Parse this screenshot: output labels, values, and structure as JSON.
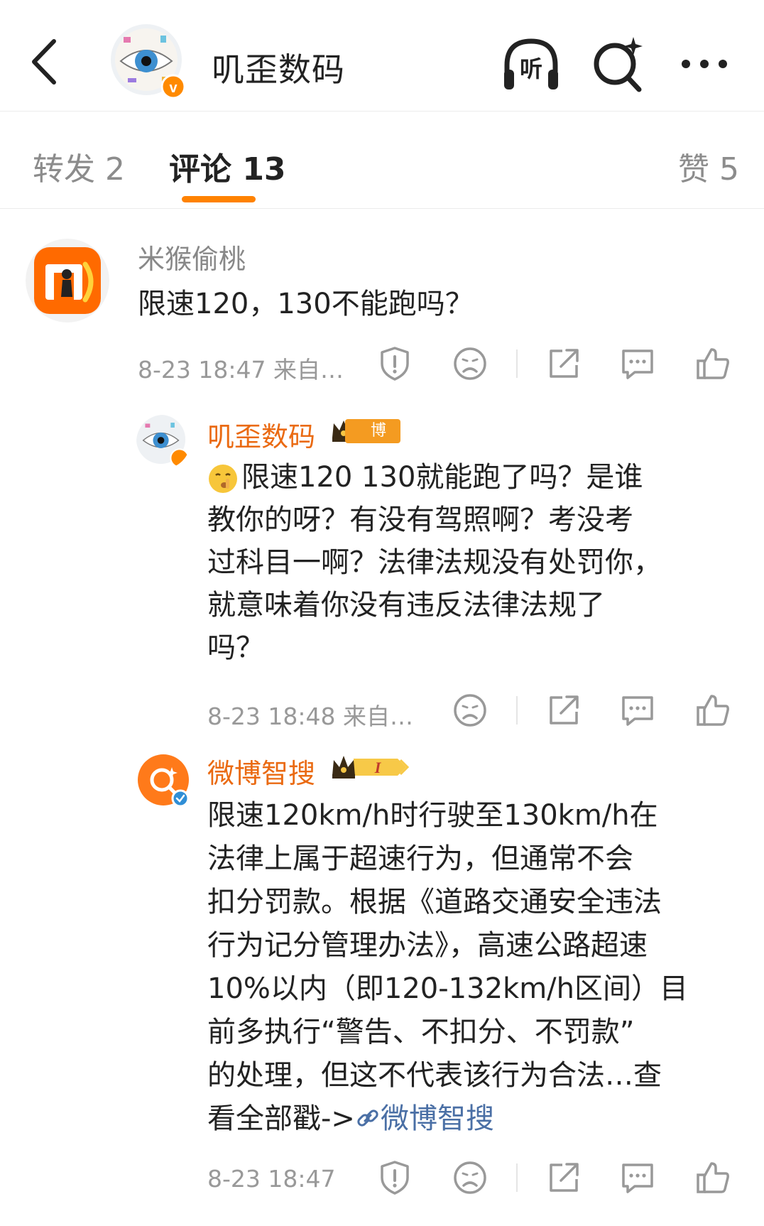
{
  "header": {
    "title": "叽歪数码",
    "listen_label": "听"
  },
  "tabs": [
    {
      "label": "转发 2"
    },
    {
      "label": "评论 13"
    },
    {
      "label": "赞 5"
    }
  ],
  "comments": [
    {
      "author": "米猴偷桃",
      "text": "限速120，130不能跑吗？",
      "meta": "8-23 18:47  来自…"
    },
    {
      "author": "叽歪数码",
      "badge": "博主",
      "text_lines": [
        "限速120 130就能跑了吗？是谁",
        "教你的呀？有没有驾照啊？考没考",
        "过科目一啊？法律法规没有处罚你，",
        "就意味着你没有违反法律法规了",
        "吗？"
      ],
      "meta": "8-23 18:48  来自…"
    },
    {
      "author": "微博智搜",
      "badge_level": "I",
      "text_lines": [
        "限速120km/h时行驶至130km/h在",
        "法律上属于超速行为，但通常不会",
        "扣分罚款。根据《道路交通安全违法",
        "行为记分管理办法》，高速公路超速",
        "10%以内（即120-132km/h区间）目",
        "前多执行“警告、不扣分、不罚款”",
        "的处理，但这不代表该行为合法…查"
      ],
      "last_line_prefix": "看全部戳->",
      "link_text": "微博智搜",
      "meta": "8-23 18:47"
    }
  ],
  "colors": {
    "accent": "#ff8200",
    "name_orange": "#ea6a12",
    "muted": "#999999",
    "link": "#4a6fa5"
  }
}
